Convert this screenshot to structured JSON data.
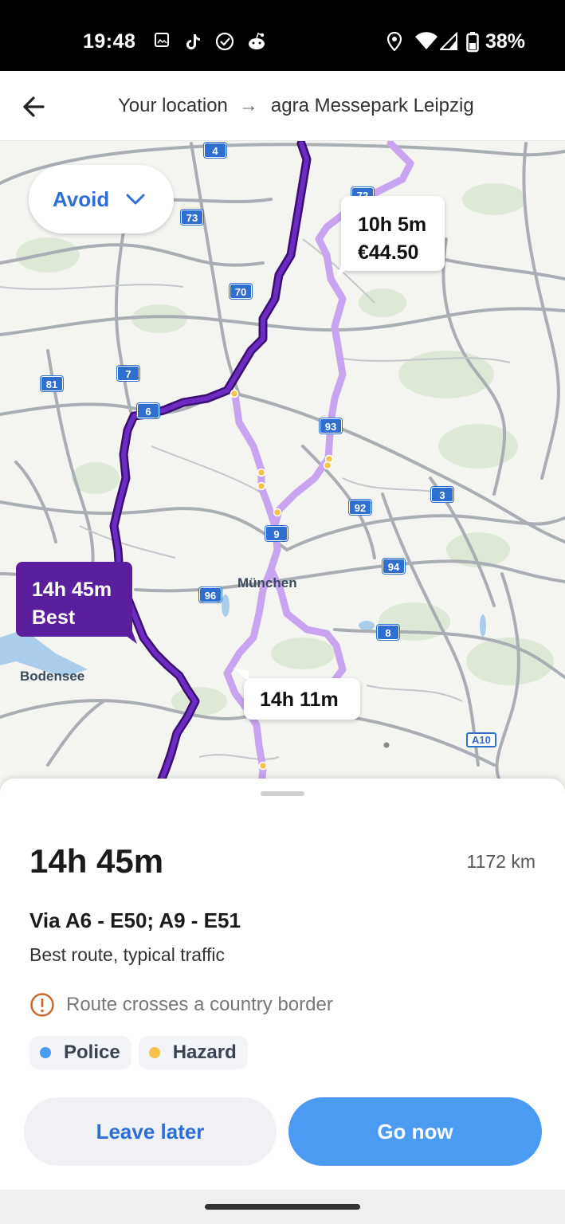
{
  "status_bar": {
    "time": "19:48",
    "battery": "38%",
    "icons": [
      "gallery-icon",
      "tiktok-icon",
      "check-circle-icon",
      "reddit-icon",
      "location-icon",
      "wifi-icon",
      "signal-icon",
      "battery-icon"
    ]
  },
  "header": {
    "origin": "Your location",
    "destination": "agra Messepark Leipzig",
    "back_icon": "back-arrow-icon",
    "separator_icon": "arrow-right-icon"
  },
  "map": {
    "avoid_label": "Avoid",
    "routes": [
      {
        "time": "10h 5m",
        "price": "€44.50"
      },
      {
        "time": "14h 45m",
        "tag": "Best"
      },
      {
        "time": "14h 11m"
      }
    ],
    "places": {
      "munich": "München",
      "bodensee": "Bodensee"
    },
    "road_shields": {
      "s4": "4",
      "s72": "72",
      "s73": "73",
      "s70": "70",
      "s81": "81",
      "s7": "7",
      "s6": "6",
      "s93": "93",
      "s3": "3",
      "s92": "92",
      "s9": "9",
      "s94": "94",
      "s96": "96",
      "s8": "8",
      "sa10": "A10"
    },
    "colors": {
      "best_route": "#5b1f9e",
      "alt_route": "#c9a4f0",
      "incident": "#f5c24a"
    }
  },
  "sheet": {
    "duration": "14h 45m",
    "distance": "1172 km",
    "via": "Via A6 - E50; A9 - E51",
    "subtitle": "Best route, typical traffic",
    "warning": "Route crosses a country border",
    "chips": [
      {
        "label": "Police",
        "color": "#4a9bf1"
      },
      {
        "label": "Hazard",
        "color": "#f5c24a"
      }
    ],
    "leave_later": "Leave later",
    "go_now": "Go now"
  }
}
